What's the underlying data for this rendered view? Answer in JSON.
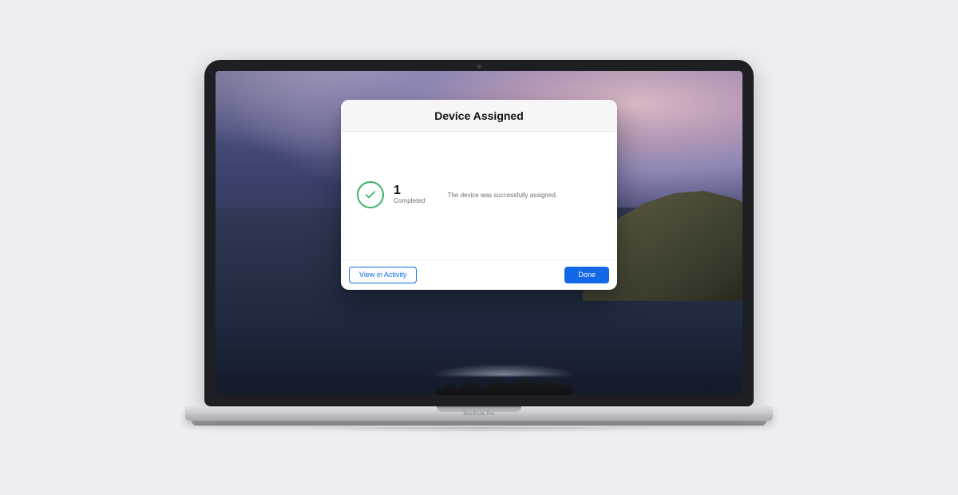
{
  "device": {
    "brand_label": "MacBook Pro"
  },
  "dialog": {
    "title": "Device Assigned",
    "status": {
      "count": "1",
      "count_label": "Completed",
      "message": "The device was successfully assigned."
    },
    "actions": {
      "view_activity_label": "View in Activity",
      "done_label": "Done"
    }
  }
}
